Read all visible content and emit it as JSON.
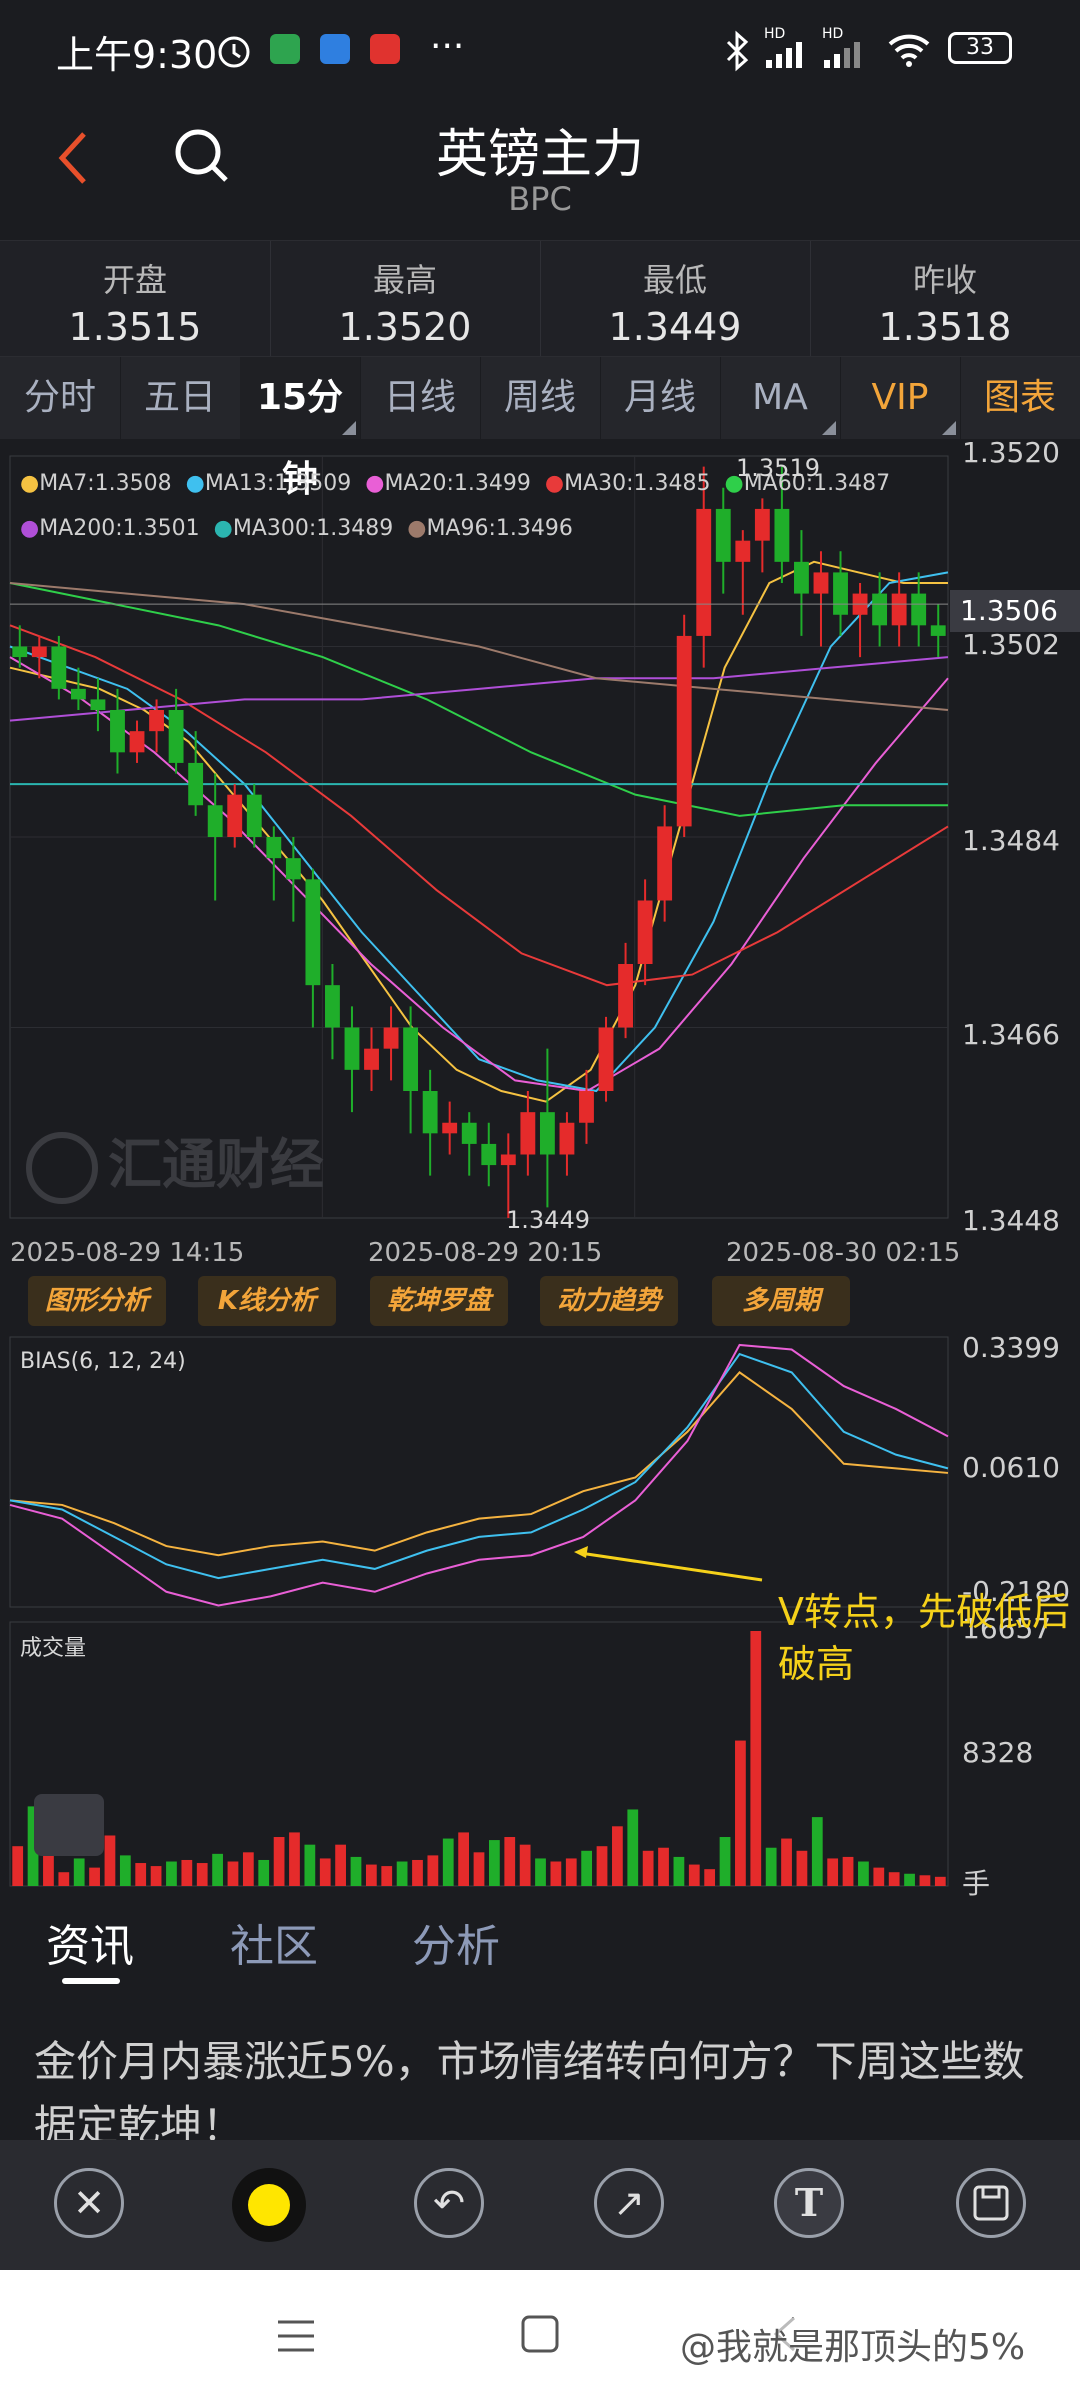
{
  "status": {
    "time": "上午9:30",
    "battery": "33",
    "net1": "HD",
    "net2": "HD",
    "more": "···"
  },
  "header": {
    "title": "英镑主力",
    "subtitle": "BPC"
  },
  "stats": [
    {
      "label": "开盘",
      "value": "1.3515"
    },
    {
      "label": "最高",
      "value": "1.3520"
    },
    {
      "label": "最低",
      "value": "1.3449"
    },
    {
      "label": "昨收",
      "value": "1.3518"
    }
  ],
  "tabs": [
    "分时",
    "五日",
    "15分钟",
    "日线",
    "周线",
    "月线",
    "MA",
    "VIP",
    "图表"
  ],
  "ma_legend": [
    {
      "text": "MA7:1.3508",
      "color": "#f5c242"
    },
    {
      "text": "MA13:1.3509",
      "color": "#3fc0ef"
    },
    {
      "text": "MA20:1.3499",
      "color": "#e95fd6"
    },
    {
      "text": "MA30:1.3485",
      "color": "#e83a3a"
    },
    {
      "text": "MA60:1.3487",
      "color": "#2fcf4a"
    },
    {
      "text": "MA200:1.3501",
      "color": "#b04fd8"
    },
    {
      "text": "MA300:1.3489",
      "color": "#2bb5b0"
    },
    {
      "text": "MA96:1.3496",
      "color": "#9c7a6b"
    }
  ],
  "price_axis": {
    "p1": "1.3520",
    "p2": "1.3506",
    "p3": "1.3502",
    "p4": "1.3484",
    "p5": "1.3466",
    "p6": "1.3448"
  },
  "hi_label": "1.3519",
  "lo_label": "1.3449",
  "watermark": "汇通财经",
  "dates": [
    "2025-08-29 14:15",
    "2025-08-29 20:15",
    "2025-08-30 02:15"
  ],
  "analysis_buttons": [
    "图形分析",
    "K线分析",
    "乾坤罗盘",
    "动力趋势",
    "多周期"
  ],
  "bias": {
    "label": "BIAS(6, 12, 24)",
    "top": "0.3399",
    "mid": "0.0610",
    "bot": "-0.2180"
  },
  "annotation": {
    "line1": "V转点，先破低后",
    "line2": "破高"
  },
  "volume": {
    "label": "成交量",
    "top": "16657",
    "mid": "8328",
    "unit": "手"
  },
  "news_tabs": [
    "资讯",
    "社区",
    "分析"
  ],
  "headline": "金价月内暴涨近5%，市场情绪转向何方？下周这些数据定乾坤！",
  "toolbar": {
    "close": "✕",
    "undo": "↶",
    "arrow": "↗",
    "text": "T"
  },
  "navbar_watermark": "@我就是那顶头的5%",
  "colors": {
    "up": "#e52b2b",
    "down": "#1fae2a",
    "bg": "#1b1c20",
    "accent": "#f3a53a"
  },
  "chart_data": {
    "type": "candlestick",
    "interval": "15分钟",
    "ylim": [
      1.3448,
      1.352
    ],
    "candles": [
      [
        1.3502,
        1.3504,
        1.35,
        1.3501
      ],
      [
        1.3501,
        1.3503,
        1.3499,
        1.3502
      ],
      [
        1.3502,
        1.3503,
        1.3497,
        1.3498
      ],
      [
        1.3498,
        1.35,
        1.3496,
        1.3497
      ],
      [
        1.3497,
        1.3499,
        1.3494,
        1.3496
      ],
      [
        1.3496,
        1.3498,
        1.349,
        1.3492
      ],
      [
        1.3492,
        1.3495,
        1.3491,
        1.3494
      ],
      [
        1.3494,
        1.3497,
        1.3492,
        1.3496
      ],
      [
        1.3496,
        1.3498,
        1.349,
        1.3491
      ],
      [
        1.3491,
        1.3494,
        1.3486,
        1.3487
      ],
      [
        1.3487,
        1.349,
        1.3478,
        1.3484
      ],
      [
        1.3484,
        1.3489,
        1.3483,
        1.3488
      ],
      [
        1.3488,
        1.3489,
        1.3483,
        1.3484
      ],
      [
        1.3484,
        1.3485,
        1.3478,
        1.3482
      ],
      [
        1.3482,
        1.3484,
        1.3476,
        1.348
      ],
      [
        1.348,
        1.3481,
        1.3466,
        1.347
      ],
      [
        1.347,
        1.3472,
        1.3463,
        1.3466
      ],
      [
        1.3466,
        1.3468,
        1.3458,
        1.3462
      ],
      [
        1.3462,
        1.3466,
        1.346,
        1.3464
      ],
      [
        1.3464,
        1.3468,
        1.3461,
        1.3466
      ],
      [
        1.3466,
        1.3468,
        1.3456,
        1.346
      ],
      [
        1.346,
        1.3462,
        1.3452,
        1.3456
      ],
      [
        1.3456,
        1.3459,
        1.3454,
        1.3457
      ],
      [
        1.3457,
        1.3458,
        1.3452,
        1.3455
      ],
      [
        1.3455,
        1.3457,
        1.3451,
        1.3453
      ],
      [
        1.3453,
        1.3456,
        1.3448,
        1.3454
      ],
      [
        1.3454,
        1.346,
        1.3452,
        1.3458
      ],
      [
        1.3458,
        1.3464,
        1.3449,
        1.3454
      ],
      [
        1.3454,
        1.3458,
        1.3452,
        1.3457
      ],
      [
        1.3457,
        1.3462,
        1.3455,
        1.346
      ],
      [
        1.346,
        1.3467,
        1.3459,
        1.3466
      ],
      [
        1.3466,
        1.3474,
        1.3465,
        1.3472
      ],
      [
        1.3472,
        1.348,
        1.347,
        1.3478
      ],
      [
        1.3478,
        1.3487,
        1.3476,
        1.3485
      ],
      [
        1.3485,
        1.3505,
        1.3484,
        1.3503
      ],
      [
        1.3503,
        1.3519,
        1.35,
        1.3515
      ],
      [
        1.3515,
        1.3517,
        1.3507,
        1.351
      ],
      [
        1.351,
        1.3513,
        1.3505,
        1.3512
      ],
      [
        1.3512,
        1.3516,
        1.3509,
        1.3515
      ],
      [
        1.3515,
        1.3519,
        1.3508,
        1.351
      ],
      [
        1.351,
        1.3513,
        1.3503,
        1.3507
      ],
      [
        1.3507,
        1.3511,
        1.3502,
        1.3509
      ],
      [
        1.3509,
        1.3511,
        1.3503,
        1.3505
      ],
      [
        1.3505,
        1.3508,
        1.3501,
        1.3507
      ],
      [
        1.3507,
        1.3509,
        1.3502,
        1.3504
      ],
      [
        1.3504,
        1.3509,
        1.3502,
        1.3507
      ],
      [
        1.3507,
        1.3509,
        1.3502,
        1.3504
      ],
      [
        1.3504,
        1.3506,
        1.3501,
        1.3503
      ]
    ],
    "ma_series": {
      "MA7": [
        1.35,
        1.3499,
        1.3498,
        1.3496,
        1.3493,
        1.3488,
        1.3483,
        1.3478,
        1.3472,
        1.3466,
        1.3462,
        1.346,
        1.3459,
        1.3462,
        1.347,
        1.3485,
        1.35,
        1.3508,
        1.351,
        1.3509,
        1.3508,
        1.3508
      ],
      "MA13": [
        1.3502,
        1.35,
        1.3498,
        1.3494,
        1.3489,
        1.3482,
        1.3475,
        1.3469,
        1.3463,
        1.3461,
        1.346,
        1.3466,
        1.3476,
        1.349,
        1.3502,
        1.3508,
        1.3509
      ],
      "MA20": [
        1.3501,
        1.3497,
        1.3492,
        1.3486,
        1.3479,
        1.3472,
        1.3466,
        1.3461,
        1.346,
        1.3464,
        1.3472,
        1.3482,
        1.3491,
        1.3499
      ],
      "MA30": [
        1.3504,
        1.3501,
        1.3497,
        1.3492,
        1.3486,
        1.3479,
        1.3473,
        1.347,
        1.3471,
        1.3475,
        1.348,
        1.3485
      ],
      "MA60": [
        1.3508,
        1.3506,
        1.3504,
        1.3501,
        1.3497,
        1.3492,
        1.3488,
        1.3486,
        1.3487,
        1.3487
      ],
      "MA200": [
        1.3495,
        1.3496,
        1.3497,
        1.3497,
        1.3498,
        1.3499,
        1.3499,
        1.35,
        1.3501
      ],
      "MA300": [
        1.3489,
        1.3489,
        1.3489,
        1.3489,
        1.3489,
        1.3489,
        1.3489,
        1.3489,
        1.3489
      ],
      "MA96": [
        1.3508,
        1.3507,
        1.3506,
        1.3504,
        1.3502,
        1.3499,
        1.3498,
        1.3497,
        1.3496
      ]
    },
    "bias_series": {
      "BIAS6": [
        0.0,
        -0.01,
        -0.05,
        -0.1,
        -0.12,
        -0.1,
        -0.09,
        -0.11,
        -0.07,
        -0.04,
        -0.03,
        0.02,
        0.05,
        0.15,
        0.28,
        0.2,
        0.08,
        0.07,
        0.06
      ],
      "BIAS12": [
        0.0,
        -0.02,
        -0.08,
        -0.14,
        -0.17,
        -0.15,
        -0.13,
        -0.15,
        -0.11,
        -0.08,
        -0.07,
        -0.02,
        0.04,
        0.16,
        0.32,
        0.28,
        0.15,
        0.1,
        0.07
      ],
      "BIAS24": [
        -0.01,
        -0.04,
        -0.12,
        -0.2,
        -0.23,
        -0.21,
        -0.18,
        -0.2,
        -0.16,
        -0.13,
        -0.12,
        -0.08,
        0.0,
        0.13,
        0.34,
        0.33,
        0.25,
        0.2,
        0.14
      ]
    },
    "volume": [
      2600,
      5200,
      2100,
      900,
      1800,
      1200,
      3300,
      2000,
      1500,
      1300,
      1600,
      1700,
      1500,
      2100,
      1600,
      2200,
      1700,
      3200,
      3500,
      2700,
      1800,
      2700,
      1900,
      1400,
      1300,
      1600,
      1700,
      2000,
      3100,
      3500,
      2200,
      3000,
      3200,
      2700,
      1800,
      1600,
      1800,
      2300,
      2600,
      3900,
      5000,
      2300,
      2500,
      1900,
      1400,
      1100,
      3200,
      9500,
      16657,
      2500,
      3100,
      2300,
      4500,
      1800,
      1900,
      1600,
      1200,
      900,
      800,
      700,
      600
    ]
  }
}
